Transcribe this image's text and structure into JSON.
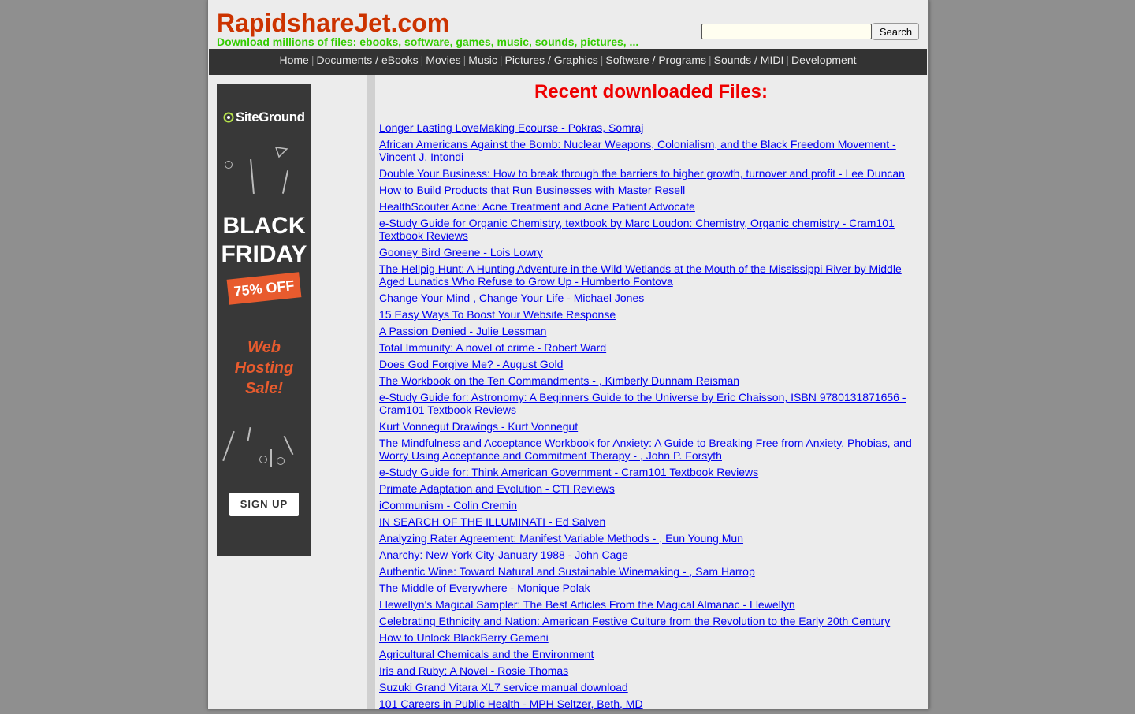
{
  "header": {
    "site_title": "RapidshareJet.com",
    "tagline": "Download millions of files: ebooks, software, games, music, sounds, pictures, ...",
    "search_value": "",
    "search_button": "Search"
  },
  "nav": {
    "items": [
      "Home",
      "Documents / eBooks",
      "Movies",
      "Music",
      "Pictures / Graphics",
      "Software / Programs",
      "Sounds / MIDI",
      "Development"
    ],
    "separator": "|"
  },
  "ad": {
    "brand": "SiteGround",
    "line1": "BLACK",
    "line2": "FRIDAY",
    "discount": "75% OFF",
    "sale1": "Web",
    "sale2": "Hosting",
    "sale3": "Sale!",
    "cta": "SIGN UP",
    "colors": {
      "background": "#383838",
      "accent": "#e85b2e"
    }
  },
  "main": {
    "title": "Recent downloaded Files:",
    "files": [
      "Longer Lasting LoveMaking Ecourse - Pokras, Somraj",
      "African Americans Against the Bomb: Nuclear Weapons, Colonialism, and the Black Freedom Movement - Vincent J. Intondi",
      "Double Your Business: How to break through the barriers to higher growth, turnover and profit - Lee Duncan",
      "How to Build Products that Run Businesses with Master Resell",
      "HealthScouter Acne: Acne Treatment and Acne Patient Advocate",
      "e-Study Guide for Organic Chemistry, textbook by Marc Loudon: Chemistry, Organic chemistry - Cram101 Textbook Reviews",
      "Gooney Bird Greene - Lois Lowry",
      "The Hellpig Hunt: A Hunting Adventure in the Wild Wetlands at the Mouth of the Mississippi River by Middle Aged Lunatics Who Refuse to Grow Up - Humberto Fontova",
      "Change Your Mind , Change Your Life - Michael Jones",
      "15 Easy Ways To Boost Your Website Response",
      "A Passion Denied - Julie Lessman",
      "Total Immunity: A novel of crime - Robert Ward",
      "Does God Forgive Me? - August Gold",
      "The Workbook on the Ten Commandments - , Kimberly Dunnam Reisman",
      "e-Study Guide for: Astronomy: A Beginners Guide to the Universe by Eric Chaisson, ISBN 9780131871656 - Cram101 Textbook Reviews",
      "Kurt Vonnegut Drawings - Kurt Vonnegut",
      "The Mindfulness and Acceptance Workbook for Anxiety: A Guide to Breaking Free from Anxiety, Phobias, and Worry Using Acceptance and Commitment Therapy - , John P. Forsyth",
      "e-Study Guide for: Think American Government - Cram101 Textbook Reviews",
      "Primate Adaptation and Evolution - CTI Reviews",
      "iCommunism - Colin Cremin",
      "IN SEARCH OF THE ILLUMINATI - Ed Salven",
      "Analyzing Rater Agreement: Manifest Variable Methods - , Eun Young Mun",
      "Anarchy: New York City-January 1988 - John Cage",
      "Authentic Wine: Toward Natural and Sustainable Winemaking - , Sam Harrop",
      "The Middle of Everywhere - Monique Polak",
      "Llewellyn's Magical Sampler: The Best Articles From the Magical Almanac - Llewellyn",
      "Celebrating Ethnicity and Nation: American Festive Culture from the Revolution to the Early 20th Century",
      "How to Unlock BlackBerry Gemeni",
      "Agricultural Chemicals and the Environment",
      "Iris and Ruby: A Novel - Rosie Thomas",
      "Suzuki Grand Vitara XL7 service manual download",
      "101 Careers in Public Health - MPH Seltzer, Beth, MD"
    ]
  },
  "colors": {
    "title": "#cc3300",
    "tagline": "#33cc00",
    "heading": "#ee0000",
    "link": "#0000ee",
    "navbar": "#333333"
  }
}
